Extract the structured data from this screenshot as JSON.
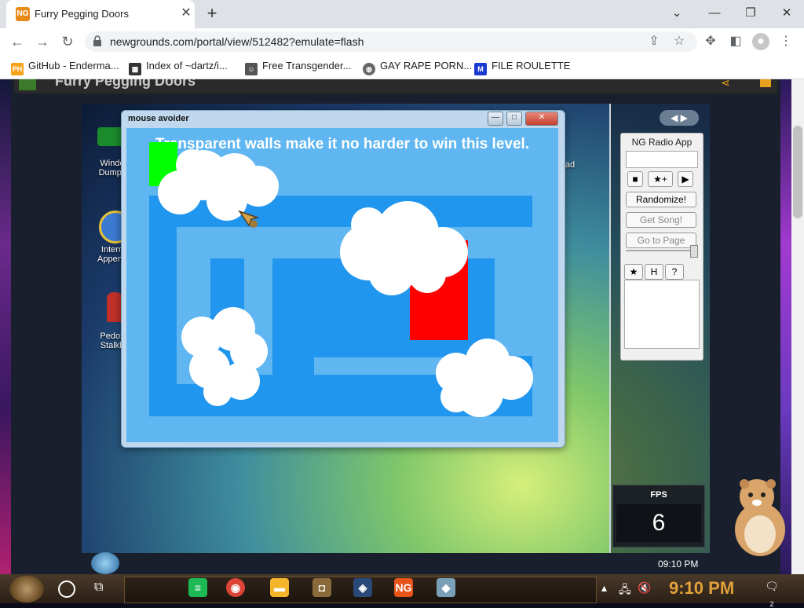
{
  "tab": {
    "favicon": "NG",
    "title": "Furry Pegging Doors",
    "close": "✕",
    "new_tab": "+"
  },
  "window_controls": {
    "minimize": "⌄",
    "min": "—",
    "restore": "❐",
    "close": "✕"
  },
  "nav": {
    "back": "←",
    "forward": "→",
    "reload": "↻"
  },
  "address": {
    "url": "newgrounds.com/portal/view/512482?emulate=flash"
  },
  "bookmarks": [
    {
      "label": "GitHub - Enderma...",
      "icon": "PH",
      "color": "#f7a21a"
    },
    {
      "label": "Index of ~dartz/i...",
      "icon": "▦",
      "color": "#333333"
    },
    {
      "label": "Free Transgender...",
      "icon": "☺",
      "color": "#555555"
    },
    {
      "label": "GAY RAPE PORN...",
      "icon": "◍",
      "color": "#666666"
    },
    {
      "label": "FILE ROULETTE",
      "icon": "M",
      "color": "#1a3ad0"
    }
  ],
  "page": {
    "ng_title": "Furry Pegging Doors"
  },
  "desktop": {
    "icons": [
      {
        "label": "Windo\nDumps"
      },
      {
        "label": "Intern\nAppend"
      },
      {
        "label": "Pedos\nStalkh"
      }
    ],
    "right_label": "pad"
  },
  "flash_window": {
    "title": "mouse avoider",
    "buttons": {
      "minimize": "—",
      "maximize": "□",
      "close": "✕"
    },
    "message": "Transparent walls make it no harder to win this level."
  },
  "radio": {
    "title": "NG Radio App",
    "stop": "■",
    "fav": "★+",
    "play": "▶",
    "randomize": "Randomize!",
    "get_song": "Get Song!",
    "go_to_page": "Go to Page",
    "tabs": [
      "★",
      "H",
      "?"
    ],
    "nav": "◀ ▶"
  },
  "fps": {
    "label": "FPS",
    "value": "6"
  },
  "desktop_clock": "09:10 PM",
  "taskbar": {
    "time": "9:10 PM",
    "apps": [
      {
        "name": "spotify",
        "glyph": "≡",
        "color": "#1db954"
      },
      {
        "name": "chrome",
        "glyph": "◉",
        "color": "#db4437"
      },
      {
        "name": "explorer",
        "glyph": "▬",
        "color": "#f3b52a"
      },
      {
        "name": "dosbox",
        "glyph": "◘",
        "color": "#8a6a3a"
      },
      {
        "name": "virtualbox",
        "glyph": "◈",
        "color": "#2a4a7a"
      },
      {
        "name": "newgrounds",
        "glyph": "NG",
        "color": "#e8531a"
      },
      {
        "name": "tool",
        "glyph": "◆",
        "color": "#7aa0b8"
      }
    ],
    "notification_count": "2"
  },
  "colors": {
    "accent": "#f7a21a",
    "playfield": "#60b6f0",
    "wall": "#2196ee",
    "start": "#00ff00",
    "goal": "#ff0000"
  }
}
